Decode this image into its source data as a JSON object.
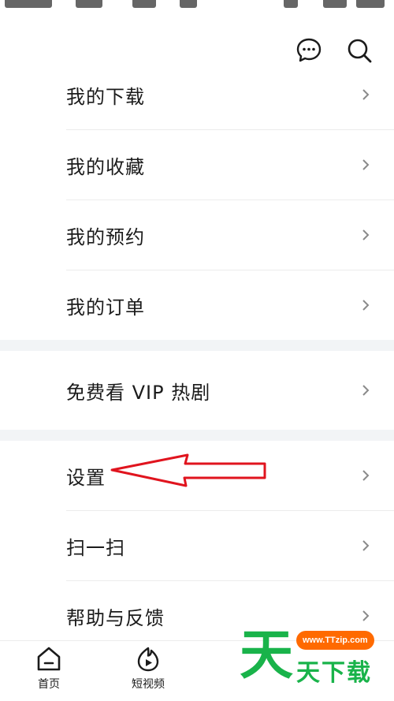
{
  "colors": {
    "separator_band": "#f2f4f6",
    "annotation_arrow": "#e0141e",
    "brand_green": "#19b34a",
    "watermark_orange": "#ff6a00"
  },
  "header": {
    "icons": [
      "message-icon",
      "search-icon"
    ]
  },
  "menu": {
    "group1": [
      {
        "label": "我的下载"
      },
      {
        "label": "我的收藏"
      },
      {
        "label": "我的预约"
      },
      {
        "label": "我的订单"
      }
    ],
    "group2": [
      {
        "label": "免费看 VIP 热剧"
      }
    ],
    "group3": [
      {
        "label": "设置"
      },
      {
        "label": "扫一扫"
      },
      {
        "label": "帮助与反馈"
      }
    ]
  },
  "tabbar": {
    "tabs": [
      {
        "label": "首页",
        "icon": "home-icon"
      },
      {
        "label": "短视频",
        "icon": "short-video-icon"
      }
    ]
  },
  "watermark": {
    "url": "www.TTzip.com",
    "big_char": "天",
    "text": "天下载"
  }
}
